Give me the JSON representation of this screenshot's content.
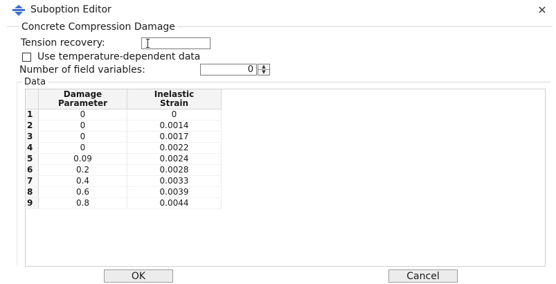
{
  "window": {
    "title": "Suboption Editor",
    "close_glyph": "✕",
    "icon": "suboption-editor-icon"
  },
  "group": {
    "title": "Concrete Compression Damage"
  },
  "tension": {
    "label": "Tension recovery:",
    "value": ""
  },
  "temperature": {
    "label": "Use temperature-dependent data",
    "checked": false
  },
  "field_vars": {
    "label": "Number of field variables:",
    "value": "0"
  },
  "data_group": {
    "title": "Data"
  },
  "table": {
    "headers": [
      {
        "line1": "Damage",
        "line2": "Parameter"
      },
      {
        "line1": "Inelastic",
        "line2": "Strain"
      }
    ],
    "rows": [
      {
        "n": "1",
        "damage": "0",
        "strain": "0"
      },
      {
        "n": "2",
        "damage": "0",
        "strain": "0.0014"
      },
      {
        "n": "3",
        "damage": "0",
        "strain": "0.0017"
      },
      {
        "n": "4",
        "damage": "0",
        "strain": "0.0022"
      },
      {
        "n": "5",
        "damage": "0.09",
        "strain": "0.0024"
      },
      {
        "n": "6",
        "damage": "0.2",
        "strain": "0.0028"
      },
      {
        "n": "7",
        "damage": "0.4",
        "strain": "0.0033"
      },
      {
        "n": "8",
        "damage": "0.6",
        "strain": "0.0039"
      },
      {
        "n": "9",
        "damage": "0.8",
        "strain": "0.0044"
      }
    ]
  },
  "buttons": {
    "ok": "OK",
    "cancel": "Cancel"
  }
}
